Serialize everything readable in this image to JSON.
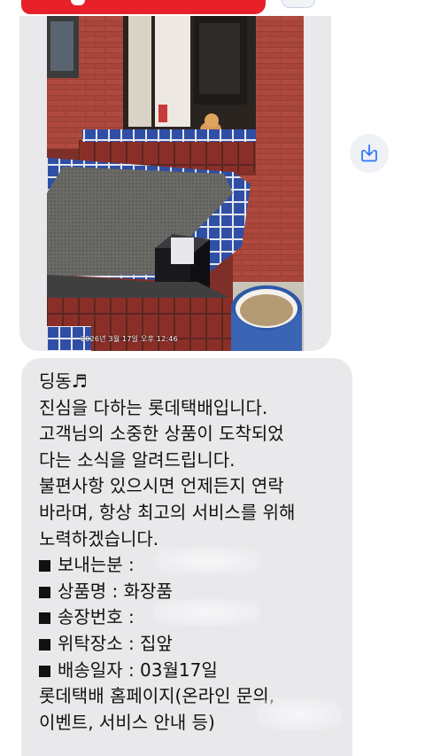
{
  "conversation": {
    "photo_message": {
      "timestamp_overlay": "2026년 3월 17일 오후 12:46"
    },
    "download_button": {
      "icon": "download-icon",
      "color": "#3478f6"
    },
    "text_message": {
      "greeting": "딩동♬",
      "lines": [
        "진심을 다하는 롯데택배입니다.",
        "고객님의 소중한 상품이 도착되었",
        "다는 소식을 알려드립니다.",
        "불편사항 있으시면 언제든지 연락",
        "바라며, 항상 최고의 서비스를 위해",
        "노력하겠습니다."
      ],
      "details": {
        "sender": "보내는분 :",
        "product": "상품명 : 화장품",
        "tracking_number": "송장번호 :",
        "drop_location": "위탁장소 : 집앞",
        "delivery_date": "배송일자 : 03월17일"
      },
      "footer_lines": [
        "롯데택배 홈페이지(온라인 문의,",
        "이벤트, 서비스 안내 등)"
      ]
    }
  },
  "colors": {
    "banner_red": "#e8202a",
    "bubble_gray": "#e9e9eb"
  }
}
